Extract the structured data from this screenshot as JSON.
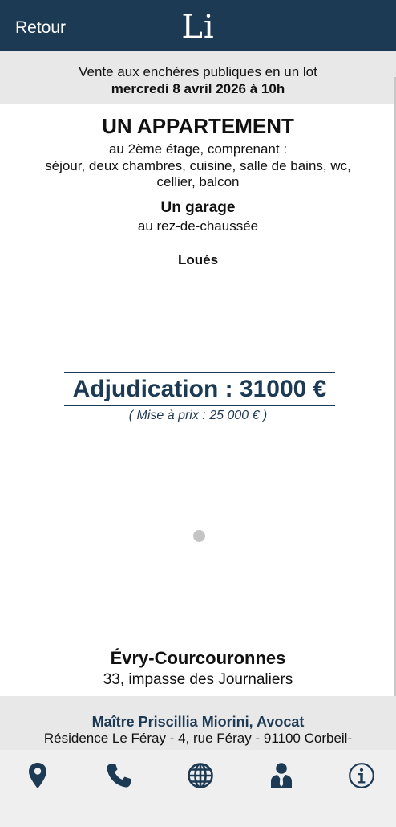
{
  "header": {
    "back_label": "Retour",
    "logo_text": "Li"
  },
  "sale": {
    "line1": "Vente aux enchères publiques en un lot",
    "line2": "mercredi 8 avril 2026 à 10h"
  },
  "property": {
    "title": "UN APPARTEMENT",
    "lines": [
      "au 2ème étage, comprenant :",
      "séjour, deux chambres, cuisine, salle de bains, wc,",
      "cellier, balcon"
    ],
    "garage_title": "Un garage",
    "garage_detail": "au rez-de-chaussée",
    "status": "Loués"
  },
  "price": {
    "adjudication": "Adjudication : 31000 €",
    "mise_a_prix": "( Mise à prix : 25 000 € )"
  },
  "location": {
    "city": "Évry-Courcouronnes",
    "street": "33, impasse des Journaliers"
  },
  "lawyer": {
    "name": "Maître Priscillia Miorini, Avocat",
    "address": "Résidence Le Féray - 4, rue Féray - 91100 Corbeil-"
  },
  "tabbar": {
    "icons": [
      "map-pin-icon",
      "phone-icon",
      "globe-icon",
      "lawyer-icon",
      "info-icon"
    ],
    "icon_color": "#1d3a55"
  },
  "colors": {
    "navy": "#1d3a55",
    "banner_gray": "#e8e8e8"
  }
}
